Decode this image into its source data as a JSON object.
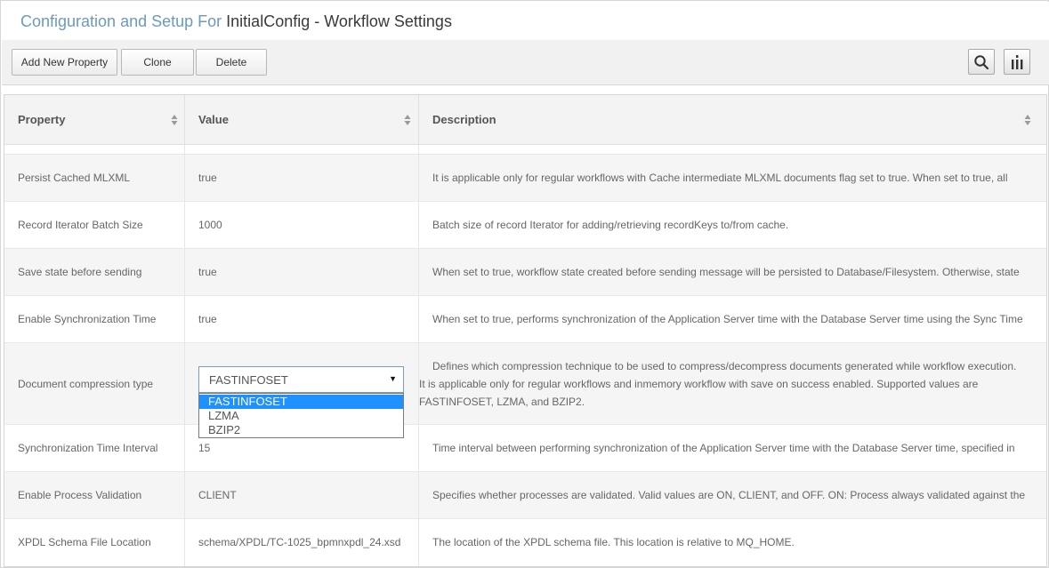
{
  "header": {
    "title_prefix": "Configuration and Setup For",
    "title_rest": "InitialConfig - Workflow Settings"
  },
  "toolbar": {
    "add_label": "Add New Property",
    "clone_label": "Clone",
    "delete_label": "Delete",
    "search_icon": "search-icon",
    "columns_icon": "columns-icon"
  },
  "table": {
    "columns": [
      "Property",
      "Value",
      "Description"
    ],
    "rows": [
      {
        "property": "Persist Cached MLXML",
        "value": "true",
        "description": "It is applicable only for regular workflows with Cache intermediate MLXML documents flag set to true. When set to true, all"
      },
      {
        "property": "Record Iterator Batch Size",
        "value": "1000",
        "description": "Batch size of record Iterator for adding/retrieving recordKeys to/from cache."
      },
      {
        "property": "Save state before sending",
        "value": "true",
        "description": "When set to true, workflow state created before sending message will be persisted to Database/Filesystem. Otherwise, state"
      },
      {
        "property": "Enable Synchronization Time",
        "value": "true",
        "description": "When set to true, performs synchronization of the Application Server time with the Database Server time using the Sync Time"
      },
      {
        "property": "Document compression type",
        "value": "FASTINFOSET",
        "description_lines": [
          "Defines which compression technique to be used to compress/decompress documents generated while workflow execution.",
          "It is applicable only for regular workflows and inmemory workflow with save on success enabled. Supported values are",
          "FASTINFOSET, LZMA, and BZIP2."
        ],
        "options": [
          "FASTINFOSET",
          "LZMA",
          "BZIP2"
        ],
        "selected_option": "FASTINFOSET"
      },
      {
        "property": "Synchronization Time Interval",
        "value": "15",
        "description": "Time interval between performing synchronization of the Application Server time with the Database Server time, specified in"
      },
      {
        "property": "Enable Process Validation",
        "value": "CLIENT",
        "description": "Specifies whether processes are validated. Valid values are ON, CLIENT, and OFF. ON: Process always validated against the"
      },
      {
        "property": "XPDL Schema File Location",
        "value": "schema/XPDL/TC-1025_bpmnxpdl_24.xsd",
        "description": "The location of the XPDL schema file. This location is relative to MQ_HOME."
      }
    ]
  },
  "colors": {
    "title_accent": "#6c9ab8",
    "selected_option": "#1e90ff"
  }
}
